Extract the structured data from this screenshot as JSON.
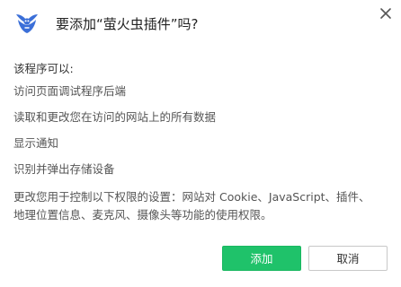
{
  "dialog": {
    "title": "要添加“萤火虫插件”吗?",
    "permissions_heading": "该程序可以:",
    "permissions": [
      "访问页面调试程序后端",
      "读取和更改您在访问的网站上的所有数据",
      "显示通知",
      "识别并弹出存储设备"
    ],
    "note_line1": "更改您用于控制以下权限的设置：网站对 Cookie、JavaScript、插件、",
    "note_line2": "地理位置信息、麦克风、摄像头等功能的使用权限。",
    "add_label": "添加",
    "cancel_label": "取消"
  },
  "colors": {
    "accent": "#1fc26a",
    "icon": "#3b6fd8"
  },
  "icons": {
    "app": "firefly-icon",
    "close": "close-icon"
  }
}
